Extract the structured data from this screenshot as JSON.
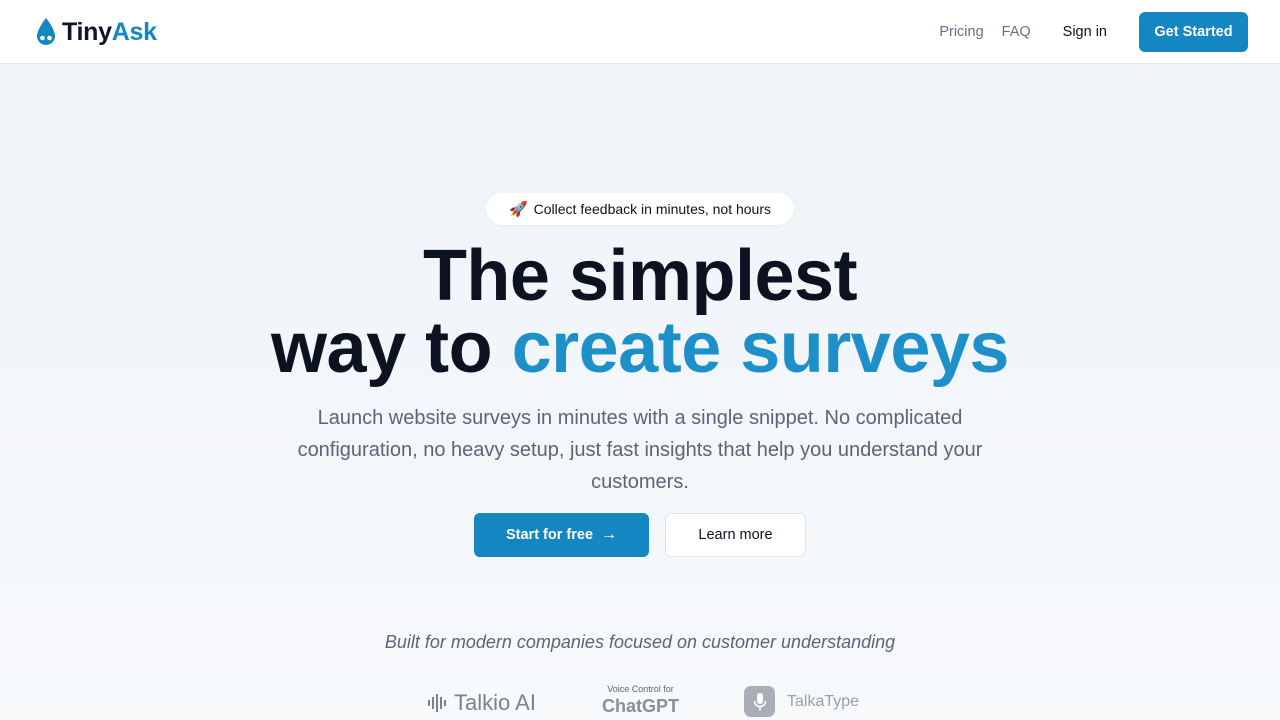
{
  "header": {
    "logo": {
      "part1": "Tiny",
      "part2": "Ask"
    },
    "nav": {
      "pricing": "Pricing",
      "faq": "FAQ"
    },
    "sign_in": "Sign in",
    "get_started": "Get Started"
  },
  "hero": {
    "badge": {
      "icon": "rocket-icon",
      "text": "Collect feedback in minutes, not hours"
    },
    "headline": {
      "line1": "The simplest",
      "line2_prefix": "way to ",
      "line2_accent": "create surveys"
    },
    "subtitle": "Launch website surveys in minutes with a single snippet. No complicated configuration, no heavy setup, just fast insights that help you understand your customers.",
    "cta_primary": "Start for free",
    "cta_secondary": "Learn more",
    "built_for": "Built for modern companies focused on customer understanding",
    "logos": {
      "talkio": "Talkio AI",
      "chatgpt_small": "Voice Control for",
      "chatgpt_big": "ChatGPT",
      "talkatype": "TalkaType"
    }
  },
  "colors": {
    "brand": "#1487c2",
    "accent_text": "#1e90c9",
    "text_dark": "#0b1220",
    "text_muted": "#5b6577"
  }
}
